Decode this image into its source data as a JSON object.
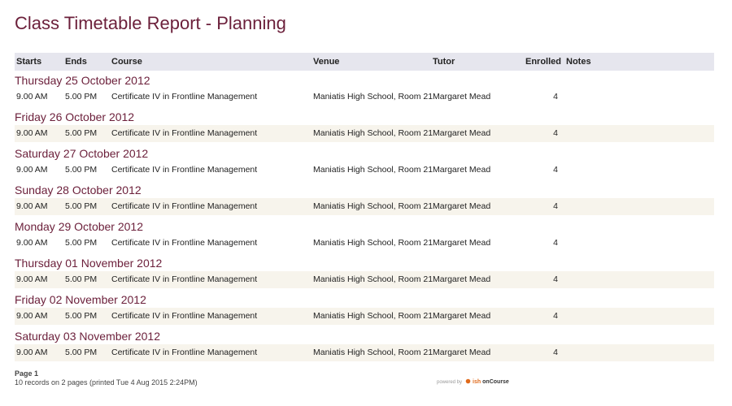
{
  "title": "Class Timetable Report - Planning",
  "columns": {
    "starts": "Starts",
    "ends": "Ends",
    "course": "Course",
    "venue": "Venue",
    "tutor": "Tutor",
    "enrolled": "Enrolled",
    "notes": "Notes"
  },
  "groups": [
    {
      "date": "Thursday 25 October 2012",
      "starts": "9.00 AM",
      "ends": "5.00 PM",
      "course": "Certificate IV in Frontline Management",
      "venue": "Maniatis High School, Room 21",
      "tutor": "Margaret Mead",
      "enrolled": "4",
      "notes": ""
    },
    {
      "date": "Friday 26 October 2012",
      "starts": "9.00 AM",
      "ends": "5.00 PM",
      "course": "Certificate IV in Frontline Management",
      "venue": "Maniatis High School, Room 21",
      "tutor": "Margaret Mead",
      "enrolled": "4",
      "notes": ""
    },
    {
      "date": "Saturday 27 October 2012",
      "starts": "9.00 AM",
      "ends": "5.00 PM",
      "course": "Certificate IV in Frontline Management",
      "venue": "Maniatis High School, Room 21",
      "tutor": "Margaret Mead",
      "enrolled": "4",
      "notes": ""
    },
    {
      "date": "Sunday 28 October 2012",
      "starts": "9.00 AM",
      "ends": "5.00 PM",
      "course": "Certificate IV in Frontline Management",
      "venue": "Maniatis High School, Room 21",
      "tutor": "Margaret Mead",
      "enrolled": "4",
      "notes": ""
    },
    {
      "date": "Monday 29 October 2012",
      "starts": "9.00 AM",
      "ends": "5.00 PM",
      "course": "Certificate IV in Frontline Management",
      "venue": "Maniatis High School, Room 21",
      "tutor": "Margaret Mead",
      "enrolled": "4",
      "notes": ""
    },
    {
      "date": "Thursday 01 November 2012",
      "starts": "9.00 AM",
      "ends": "5.00 PM",
      "course": "Certificate IV in Frontline Management",
      "venue": "Maniatis High School, Room 21",
      "tutor": "Margaret Mead",
      "enrolled": "4",
      "notes": ""
    },
    {
      "date": "Friday 02 November 2012",
      "starts": "9.00 AM",
      "ends": "5.00 PM",
      "course": "Certificate IV in Frontline Management",
      "venue": "Maniatis High School, Room 21",
      "tutor": "Margaret Mead",
      "enrolled": "4",
      "notes": ""
    },
    {
      "date": "Saturday 03 November 2012",
      "starts": "9.00 AM",
      "ends": "5.00 PM",
      "course": "Certificate IV in Frontline Management",
      "venue": "Maniatis High School, Room 21",
      "tutor": "Margaret Mead",
      "enrolled": "4",
      "notes": ""
    }
  ],
  "footer": {
    "page": "Page 1",
    "info": "10 records on 2 pages (printed Tue 4 Aug 2015 2:24PM)",
    "powered_by": "powered by",
    "brand_mark": "ish",
    "brand_name": "onCourse"
  },
  "colors": {
    "title": "#6b1f3a",
    "header_bg": "#e6e6ee",
    "alt_row_bg": "#f7f4ec",
    "brand_accent": "#e06a1b"
  }
}
